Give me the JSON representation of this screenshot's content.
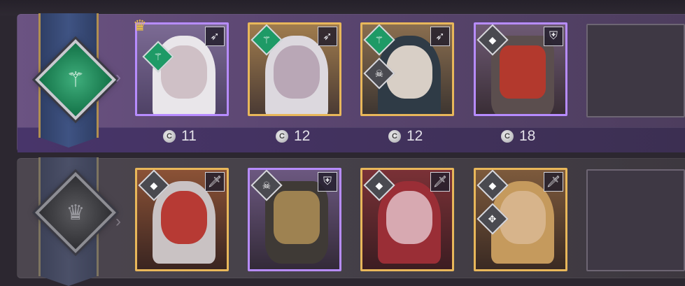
{
  "rows": [
    {
      "status": "active",
      "affinity_icon": "wing-icon",
      "slots": [
        {
          "hero_class_icon": "bow-arrows-icon",
          "affinity": "wing-icon",
          "leader": true,
          "cost": "11"
        },
        {
          "hero_class_icon": "bow-arrows-icon",
          "affinity": "wing-icon",
          "leader": false,
          "cost": "12"
        },
        {
          "hero_class_icon": "bow-arrows-icon",
          "affinity": "wing-icon",
          "leader": false,
          "cost": "12"
        },
        {
          "hero_class_icon": "shield-icon",
          "affinity": "gray-diamond-icon",
          "leader": false,
          "cost": "18"
        },
        {
          "empty": true
        }
      ]
    },
    {
      "status": "inactive",
      "affinity_icon": "crown-icon",
      "slots": [
        {
          "hero_class_icon": "sword-icon",
          "affinity": "gray-diamond-icon"
        },
        {
          "hero_class_icon": "shield-icon",
          "affinity": "skull-icon"
        },
        {
          "hero_class_icon": "sword-icon",
          "affinity": "gray-diamond-icon"
        },
        {
          "hero_class_icon": "sword-icon",
          "affinity": "gray-diamond-icon"
        },
        {
          "empty": true
        }
      ]
    }
  ],
  "colors": {
    "rare_border": "#b78cff",
    "epic_border": "#e8b75a",
    "affinity_green": "#1e9a66"
  }
}
